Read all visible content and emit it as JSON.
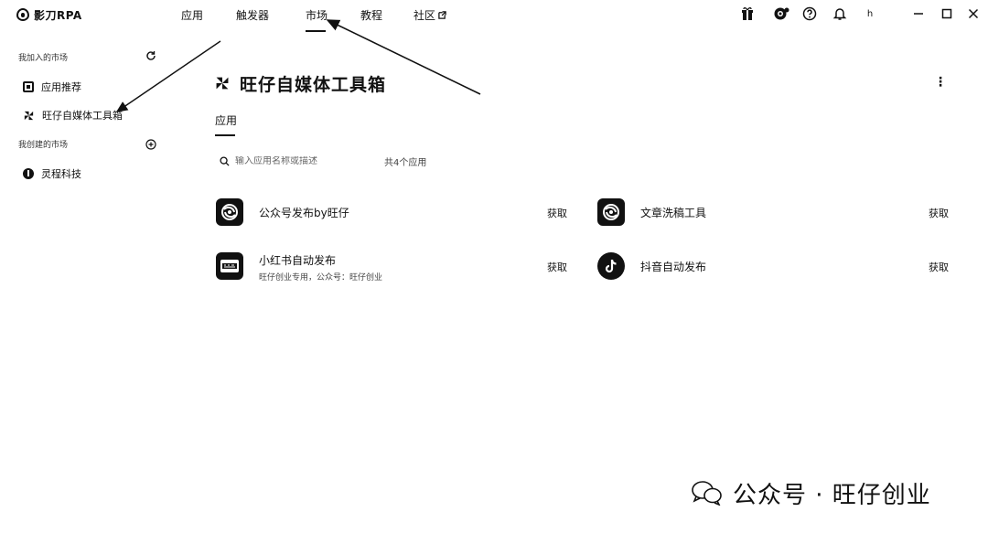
{
  "app": {
    "brand": "影刀RPA"
  },
  "nav": [
    {
      "label": "应用",
      "active": false
    },
    {
      "label": "触发器",
      "active": false
    },
    {
      "label": "市场",
      "active": true
    },
    {
      "label": "教程",
      "active": false
    },
    {
      "label": "社区",
      "active": false,
      "external_icon": "external-link-icon"
    }
  ],
  "toolbar": {
    "icons": [
      "gift-icon",
      "theme-icon",
      "help-icon",
      "bell-icon"
    ],
    "user_initial": "h"
  },
  "sidebar": {
    "joined_title": "我加入的市场",
    "created_title": "我创建的市场",
    "joined_items": [
      {
        "label": "应用推荐",
        "icon": "square-app-icon"
      },
      {
        "label": "旺仔自媒体工具箱",
        "icon": "pinwheel-icon"
      }
    ],
    "created_items": [
      {
        "label": "灵程科技",
        "icon": "circle-info-icon"
      }
    ]
  },
  "main": {
    "title": "旺仔自媒体工具箱",
    "more_label": "⋮",
    "tab": "应用",
    "search_placeholder": "输入应用名称或描述",
    "count": "共4个应用",
    "apps": [
      {
        "name": "公众号发布by旺仔",
        "desc": "",
        "action": "获取",
        "icon": "swirl-app-icon"
      },
      {
        "name": "文章洗稿工具",
        "desc": "",
        "action": "获取",
        "icon": "swirl-app-icon"
      },
      {
        "name": "小红书自动发布",
        "desc": "旺仔创业专用，公众号：旺仔创业",
        "action": "获取",
        "icon": "xiaohongshu-app-icon"
      },
      {
        "name": "抖音自动发布",
        "desc": "",
        "action": "获取",
        "icon": "douyin-app-icon"
      }
    ]
  },
  "watermark": {
    "text": "公众号 · 旺仔创业"
  }
}
